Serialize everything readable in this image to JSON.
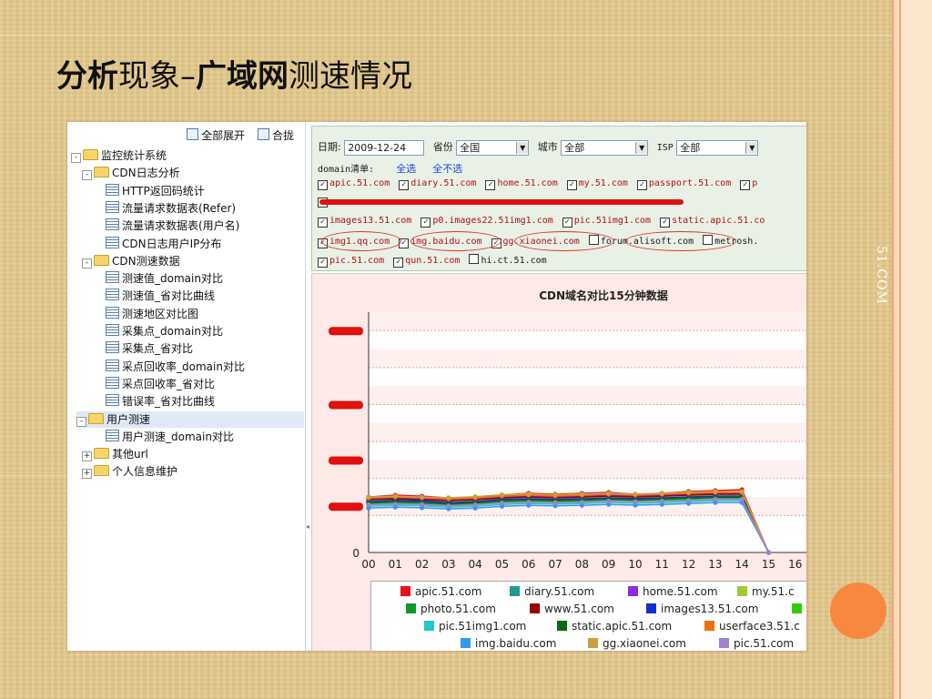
{
  "slide": {
    "title_bold": "分析",
    "title_rest": "现象–",
    "title_bold2": "广域网",
    "title_end": "测速情况",
    "side_text": "51.COM"
  },
  "tree": {
    "toolbar": {
      "expand_all": "全部展开",
      "collapse": "合拢"
    },
    "nodes": [
      {
        "label": "监控统计系统",
        "level": 0,
        "kind": "folder",
        "exp": "-"
      },
      {
        "label": "CDN日志分析",
        "level": 1,
        "kind": "folder",
        "exp": "-"
      },
      {
        "label": "HTTP返回码统计",
        "level": 2,
        "kind": "doc"
      },
      {
        "label": "流量请求数据表(Refer)",
        "level": 2,
        "kind": "doc"
      },
      {
        "label": "流量请求数据表(用户名)",
        "level": 2,
        "kind": "doc"
      },
      {
        "label": "CDN日志用户IP分布",
        "level": 2,
        "kind": "doc"
      },
      {
        "label": "CDN测速数据",
        "level": 1,
        "kind": "folder",
        "exp": "-"
      },
      {
        "label": "测速值_domain对比",
        "level": 2,
        "kind": "doc"
      },
      {
        "label": "测速值_省对比曲线",
        "level": 2,
        "kind": "doc"
      },
      {
        "label": "测速地区对比图",
        "level": 2,
        "kind": "doc"
      },
      {
        "label": "采集点_domain对比",
        "level": 2,
        "kind": "doc"
      },
      {
        "label": "采集点_省对比",
        "level": 2,
        "kind": "doc"
      },
      {
        "label": "采点回收率_domain对比",
        "level": 2,
        "kind": "doc"
      },
      {
        "label": "采点回收率_省对比",
        "level": 2,
        "kind": "doc"
      },
      {
        "label": "错误率_省对比曲线",
        "level": 2,
        "kind": "doc"
      },
      {
        "label": "用户测速",
        "level": 1,
        "kind": "folder",
        "exp": "-",
        "selected": true
      },
      {
        "label": "用户测速_domain对比",
        "level": 2,
        "kind": "doc"
      },
      {
        "label": "其他url",
        "level": 1,
        "kind": "folder",
        "exp": "+"
      },
      {
        "label": "个人信息维护",
        "level": 1,
        "kind": "folder",
        "exp": "+"
      }
    ]
  },
  "filters": {
    "date_label": "日期:",
    "date_value": "2009-12-24",
    "province_label": "省份",
    "province_value": "全国",
    "city_label": "城市",
    "city_value": "全部",
    "isp_label": "ISP",
    "isp_value": "全部",
    "domain_list_label": "domain清单:",
    "select_all": "全选",
    "select_none": "全不选",
    "row1": [
      "apic.51.com",
      "diary.51.com",
      "home.51.com",
      "my.51.com",
      "passport.51.com",
      "p"
    ],
    "row3": [
      "images13.51.com",
      "p0.images22.51img1.com",
      "pic.51img1.com",
      "static.apic.51.co"
    ],
    "row4": [
      {
        "label": "img1.qq.com",
        "checked": true
      },
      {
        "label": "img.baidu.com",
        "checked": true
      },
      {
        "label": "gg.xiaonei.com",
        "checked": true
      },
      {
        "label": "forum.alisoft.com",
        "checked": false
      },
      {
        "label": "metrosh.",
        "checked": false
      }
    ],
    "row5": [
      {
        "label": "pic.51.com",
        "checked": true
      },
      {
        "label": "qun.51.com",
        "checked": true
      },
      {
        "label": "hi.ct.51.com",
        "checked": false
      }
    ]
  },
  "chart_data": {
    "type": "line",
    "title": "CDN域名对比15分钟数据",
    "categories": [
      "00",
      "01",
      "02",
      "03",
      "04",
      "05",
      "06",
      "07",
      "08",
      "09",
      "10",
      "11",
      "12",
      "13",
      "14",
      "15",
      "16"
    ],
    "ylim": [
      0,
      1300
    ],
    "y_visible_tick": "0",
    "series": [
      {
        "name": "apic.51.com",
        "color": "#e8101a",
        "values": [
          300,
          310,
          305,
          295,
          300,
          310,
          320,
          315,
          320,
          325,
          315,
          320,
          330,
          335,
          340,
          0,
          null
        ]
      },
      {
        "name": "diary.51.com",
        "color": "#1f9a8e",
        "values": [
          270,
          280,
          275,
          265,
          270,
          285,
          290,
          285,
          290,
          295,
          290,
          295,
          300,
          305,
          305,
          0,
          null
        ]
      },
      {
        "name": "home.51.com",
        "color": "#8a2be2",
        "values": [
          290,
          295,
          290,
          285,
          290,
          300,
          305,
          300,
          305,
          310,
          305,
          310,
          315,
          320,
          320,
          0,
          null
        ]
      },
      {
        "name": "my.51.c",
        "color": "#9acd32",
        "values": [
          280,
          285,
          280,
          275,
          280,
          290,
          295,
          290,
          295,
          300,
          295,
          300,
          305,
          310,
          310,
          0,
          null
        ]
      },
      {
        "name": "photo.51.com",
        "color": "#0f9a2a",
        "values": [
          260,
          265,
          262,
          255,
          260,
          270,
          275,
          272,
          275,
          280,
          276,
          280,
          285,
          290,
          290,
          0,
          null
        ]
      },
      {
        "name": "www.51.com",
        "color": "#990000",
        "values": [
          285,
          290,
          285,
          280,
          285,
          295,
          300,
          296,
          300,
          305,
          300,
          305,
          310,
          315,
          315,
          0,
          null
        ]
      },
      {
        "name": "images13.51.com",
        "color": "#1030d0",
        "values": [
          275,
          282,
          278,
          270,
          275,
          286,
          290,
          287,
          290,
          295,
          291,
          295,
          300,
          305,
          305,
          0,
          null
        ]
      },
      {
        "name": "",
        "color": "#33cc00",
        "values": [
          265,
          270,
          268,
          260,
          266,
          276,
          280,
          277,
          280,
          285,
          281,
          285,
          290,
          295,
          295,
          0,
          null
        ]
      },
      {
        "name": "pic.51img1.com",
        "color": "#20c8d0",
        "values": [
          250,
          255,
          252,
          245,
          250,
          260,
          265,
          262,
          265,
          270,
          266,
          270,
          275,
          280,
          280,
          0,
          null
        ]
      },
      {
        "name": "static.apic.51.com",
        "color": "#0b6a10",
        "values": [
          268,
          274,
          270,
          262,
          268,
          278,
          283,
          280,
          283,
          288,
          284,
          288,
          293,
          298,
          298,
          0,
          null
        ]
      },
      {
        "name": "userface3.51.c",
        "color": "#f07010",
        "values": [
          295,
          300,
          296,
          290,
          295,
          305,
          310,
          306,
          310,
          315,
          311,
          315,
          320,
          325,
          325,
          0,
          null
        ]
      },
      {
        "name": "img.baidu.com",
        "color": "#3399ee",
        "values": [
          240,
          245,
          242,
          236,
          240,
          250,
          255,
          252,
          255,
          260,
          256,
          260,
          265,
          270,
          270,
          0,
          null
        ]
      },
      {
        "name": "gg.xiaonei.com",
        "color": "#c8a040",
        "values": [
          300,
          305,
          300,
          296,
          302,
          312,
          316,
          312,
          316,
          320,
          316,
          320,
          326,
          330,
          330,
          0,
          null
        ]
      },
      {
        "name": "pic.51.com",
        "color": "#a080d0",
        "values": [
          258,
          262,
          260,
          252,
          258,
          268,
          272,
          270,
          272,
          278,
          274,
          278,
          282,
          288,
          288,
          0,
          null
        ]
      }
    ],
    "legend_rows": [
      [
        "apic.51.com",
        "diary.51.com",
        "home.51.com",
        "my.51.c"
      ],
      [
        "photo.51.com",
        "www.51.com",
        "images13.51.com",
        ""
      ],
      [
        "pic.51img1.com",
        "static.apic.51.com",
        "userface3.51.c"
      ],
      [
        "img.baidu.com",
        "gg.xiaonei.com",
        "pic.51.com"
      ]
    ],
    "grid": true,
    "legend_position": "bottom"
  }
}
